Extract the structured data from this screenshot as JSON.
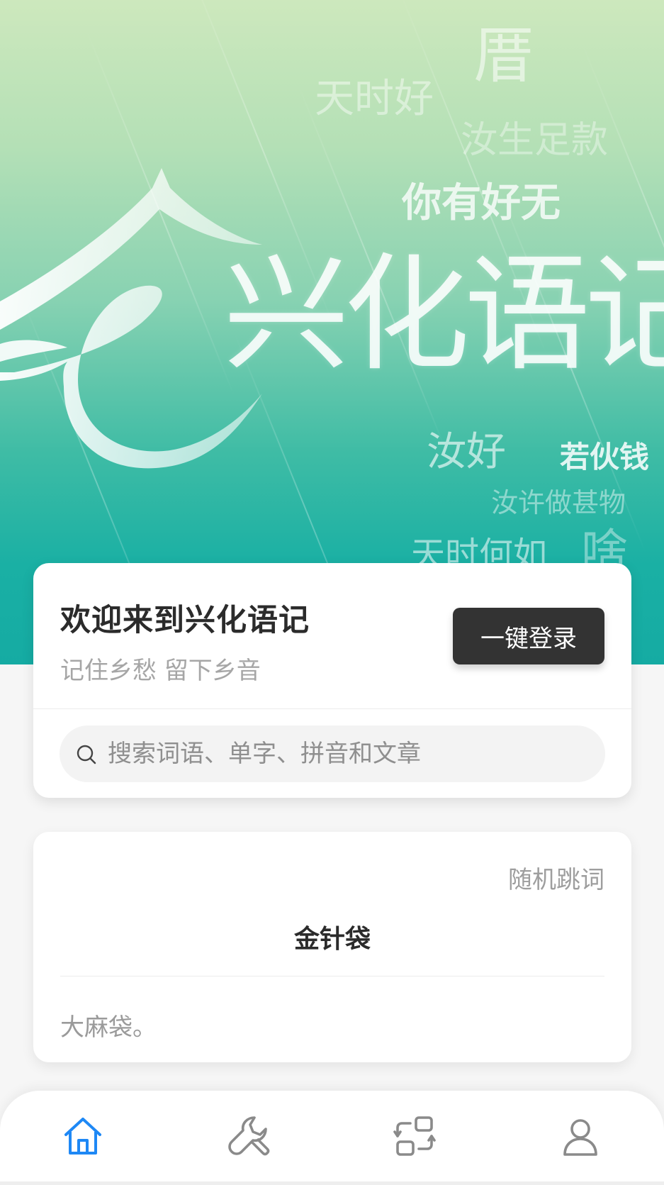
{
  "hero": {
    "logo_text": "兴化语记",
    "words": [
      "厝",
      "天时好",
      "汝生足款",
      "你有好无",
      "汝好",
      "若伙钱",
      "汝许做甚物",
      "天时何如",
      "啥"
    ]
  },
  "welcome": {
    "title": "欢迎来到兴化语记",
    "subtitle": "记住乡愁 留下乡音",
    "login_label": "一键登录"
  },
  "search": {
    "placeholder": "搜索词语、单字、拼音和文章",
    "value": ""
  },
  "word_card": {
    "random_label": "随机跳词",
    "word": "金针袋",
    "definition": "大麻袋。"
  },
  "tabbar": {
    "tabs": [
      {
        "name": "home",
        "icon": "home-icon",
        "active": true
      },
      {
        "name": "tools",
        "icon": "wrench-icon",
        "active": false
      },
      {
        "name": "convert",
        "icon": "convert-icon",
        "active": false
      },
      {
        "name": "profile",
        "icon": "user-icon",
        "active": false
      }
    ]
  },
  "colors": {
    "accent": "#1e88f5",
    "icon_inactive": "#8a8a8a",
    "login_bg": "#333333",
    "hero_top": "#cde8bd",
    "hero_bottom": "#15aba3"
  }
}
